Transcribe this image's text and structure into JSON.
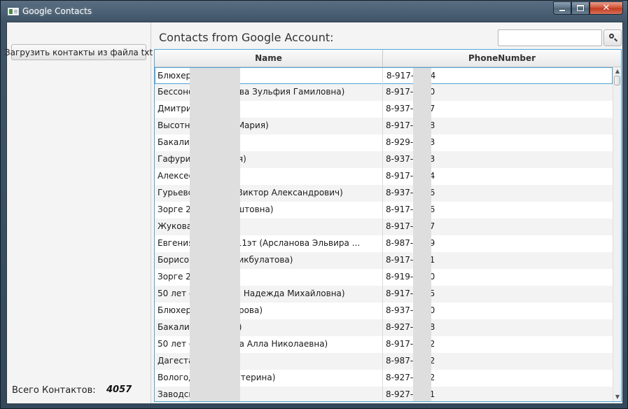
{
  "window": {
    "title": "Google Contacts",
    "minimize_glyph": "",
    "maximize_glyph": "",
    "close_glyph": "✕"
  },
  "sidebar": {
    "load_button_label": "Загрузить контакты из файла txt",
    "total_label": "Всего Контактов:",
    "total_count": "4057"
  },
  "main": {
    "title": "Contacts from Google Account:",
    "search": {
      "value": "",
      "placeholder": ""
    },
    "search_icon": "search-icon"
  },
  "table": {
    "columns": [
      "Name",
      "PhoneNumber"
    ],
    "rows": [
      {
        "name": "Блюхера",
        "phone": "8-917-    -894"
      },
      {
        "name": "Бессоно          Фаризунова Зульфия Гамиловна)",
        "phone": "8-917-    -470"
      },
      {
        "name": "Дмитрия          3-74",
        "phone": "8-937-    -497"
      },
      {
        "name": "Высотна          исярина Мария)",
        "phone": "8-917-    -358"
      },
      {
        "name": "Бакалин",
        "phone": "8-929-    -703"
      },
      {
        "name": "Гафури 9          а Альфия)",
        "phone": "8-937-    -363"
      },
      {
        "name": "Алексеев          кая 11",
        "phone": "8-917-    -424"
      },
      {
        "name": "Гурьевск          (Грачев Виктор Александрович)",
        "phone": "8-937-    -016"
      },
      {
        "name": "Зорге 28          узель Раштовна)",
        "phone": "8-917-    -776"
      },
      {
        "name": "Жукова          знецова)",
        "phone": "8-917-    -467"
      },
      {
        "name": "Евгения          а-236 2п 11эт (Арсланова Эльвира ...",
        "phone": "8-987-    -329"
      },
      {
        "name": "Борисогл          Фаина Бикбулатова)",
        "phone": "8-917-    -411"
      },
      {
        "name": "Зорге 26",
        "phone": "8-919-    -920"
      },
      {
        "name": "50 лет со          (Козлова Надежда Михайловна)",
        "phone": "8-917-    -225"
      },
      {
        "name": "Блюхера          ира Закирова)",
        "phone": "8-937-    -550"
      },
      {
        "name": "Бакалин          аргарита)",
        "phone": "8-927-    -428"
      },
      {
        "name": "50 лет ок          алиулина Алла Николаевна)",
        "phone": "8-917-    -202"
      },
      {
        "name": "Дагестан",
        "phone": "8-987-    -582"
      },
      {
        "name": "Вологод          тлова Екатерина)",
        "phone": "8-927-    -862"
      },
      {
        "name": "Заводска",
        "phone": "8-927-    -021"
      }
    ]
  },
  "colors": {
    "accent": "#4fa6d8",
    "redaction": "#dedede",
    "close_button": "#c23a1d"
  }
}
